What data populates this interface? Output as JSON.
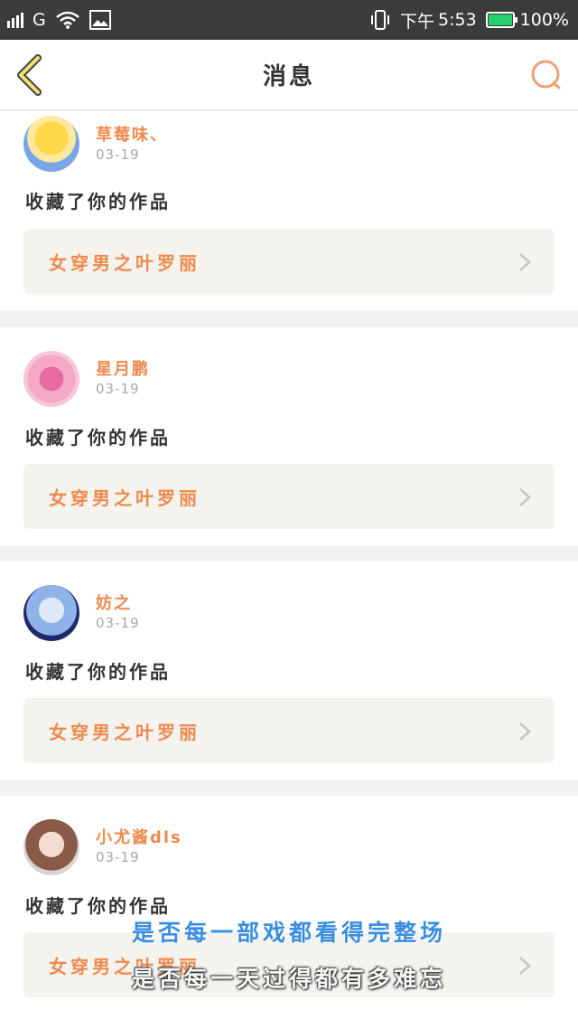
{
  "status_bar": {
    "network": "G",
    "time_prefix": "下午",
    "time": "5:53",
    "battery": "100%"
  },
  "header": {
    "title": "消息"
  },
  "messages": [
    {
      "username": "草莓味、",
      "date": "03-19",
      "action": "收藏了你的作品",
      "work_title": "女穿男之叶罗丽"
    },
    {
      "username": "星月鹏",
      "date": "03-19",
      "action": "收藏了你的作品",
      "work_title": "女穿男之叶罗丽"
    },
    {
      "username": "妨之",
      "date": "03-19",
      "action": "收藏了你的作品",
      "work_title": "女穿男之叶罗丽"
    },
    {
      "username": "小尤酱dls",
      "date": "03-19",
      "action": "收藏了你的作品",
      "work_title": "女穿男之叶罗丽"
    }
  ],
  "subtitles": {
    "line1": "是否每一部戏都看得完整场",
    "line2": "是否每一天过得都有多难忘"
  },
  "colors": {
    "accent": "#ee8a4f",
    "status_bar": "#3b3b3b",
    "battery": "#22d16a",
    "card_inner": "#f4f3ee"
  }
}
